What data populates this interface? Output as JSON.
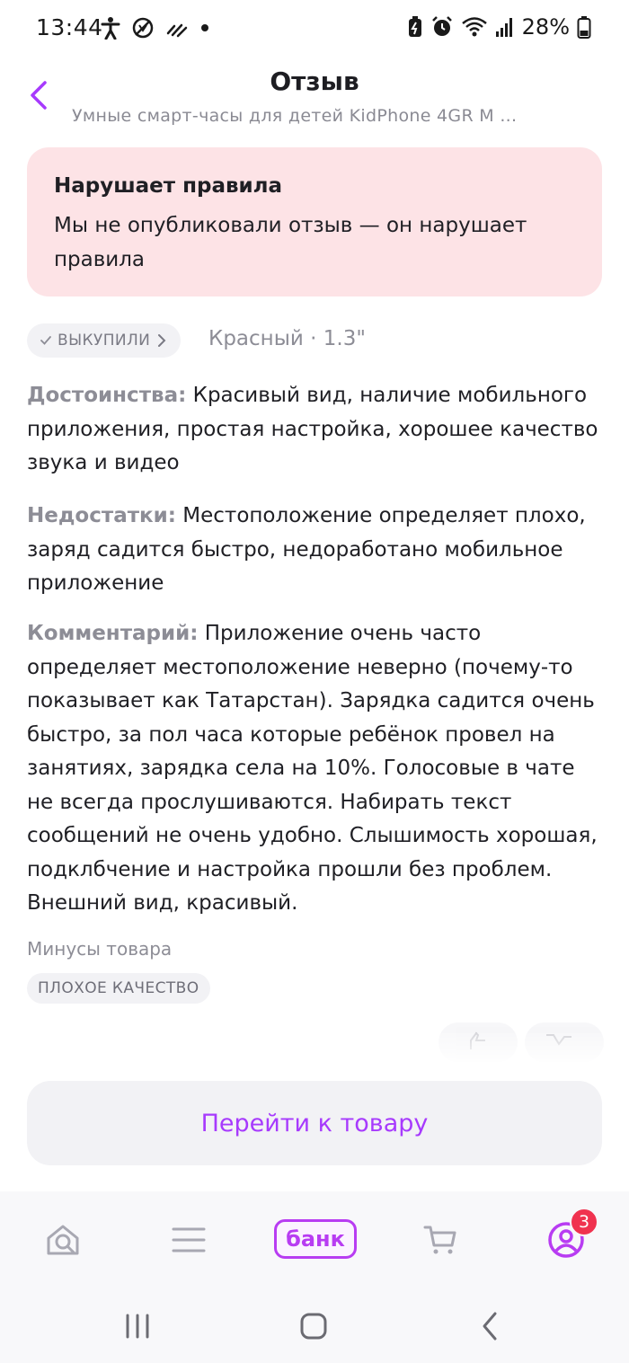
{
  "status_bar": {
    "time": "13:44",
    "battery_percent": "28%",
    "icons": [
      "accessibility-icon",
      "no-disturb-icon",
      "signal-lines-icon",
      "dot-icon",
      "battery-saver-icon",
      "alarm-icon",
      "wifi-icon",
      "cell-signal-icon",
      "battery-icon"
    ]
  },
  "header": {
    "title": "Отзыв",
    "subtitle": "Умные смарт-часы для детей KidPhone 4GR M ..."
  },
  "warning": {
    "title": "Нарушает правила",
    "text": "Мы не опубликовали отзыв — он нарушает правила"
  },
  "meta": {
    "bought_label": "ВЫКУПИЛИ",
    "variant": "Красный · 1.3\""
  },
  "review": {
    "pros_label": "Достоинства:",
    "pros_text": "Красивый вид, наличие мобильного приложения, простая настройка, хорошее качество звука и видео",
    "cons_label": "Недостатки:",
    "cons_text": "Местоположение определяет плохо, заряд садится быстро, недоработано мобильное приложение",
    "comment_label": "Комментарий:",
    "comment_text": "Приложение  очень часто определяет местоположение неверно (почему-то показывает как Татарстан). Зарядка садится очень быстро, за пол часа которые ребёнок провел на занятиях, зарядка села на 10%. Голосовые в чате не всегда прослушиваются. Набирать текст сообщений не очень удобно. Слышимость хорошая, подклбчение и настройка прошли без проблем. Внешний вид, красивый."
  },
  "minuses": {
    "title": "Минусы товара",
    "tags": [
      "ПЛОХОЕ КАЧЕСТВО"
    ]
  },
  "cta": {
    "label": "Перейти к товару"
  },
  "bottom_nav": {
    "bank_label": "банк",
    "profile_badge": "3"
  },
  "colors": {
    "accent": "#a73afd",
    "warning_bg": "#fde3e6",
    "badge_red": "#f0324f"
  }
}
